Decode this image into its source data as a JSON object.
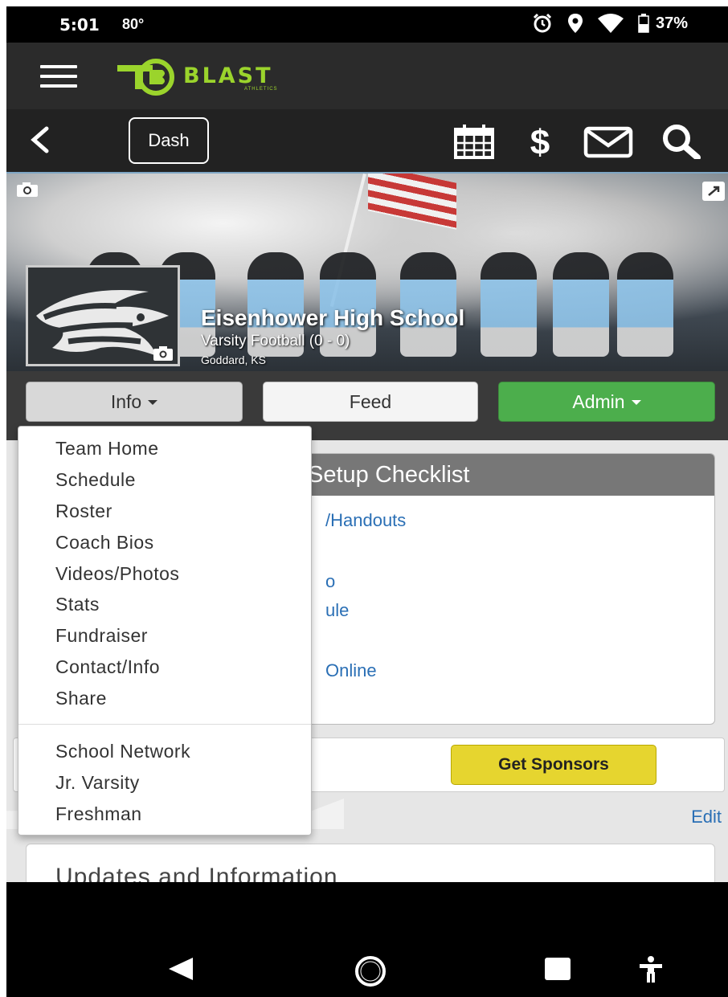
{
  "status_bar": {
    "time": "5:01",
    "temperature": "80°",
    "battery": "37%",
    "icons": [
      "alarm-icon",
      "location-icon",
      "wifi-icon",
      "battery-icon"
    ]
  },
  "brand": {
    "logo_word": "BLAST",
    "logo_sub": "ATHLETICS",
    "accent_color": "#9bd42c"
  },
  "navbar": {
    "dash_label": "Dash",
    "icons": [
      "back-icon",
      "calendar-icon",
      "dollar-icon",
      "mail-icon",
      "search-icon"
    ]
  },
  "banner": {
    "school_name": "Eisenhower High School",
    "team": "Varsity Football (0 - 0)",
    "location": "Goddard, KS"
  },
  "tabs": {
    "info": "Info",
    "feed": "Feed",
    "admin": "Admin",
    "admin_color": "#4cae4c"
  },
  "checklist": {
    "title": "Setup Checklist",
    "items_partial": [
      "/Handouts",
      "o",
      "ule",
      "Online"
    ]
  },
  "sponsors": {
    "button": "Get Sponsors",
    "button_color": "#e6d52f"
  },
  "edit_link": "Edit",
  "updates_title": "Updates and Information",
  "dropdown": {
    "primary": [
      "Team Home",
      "Schedule",
      "Roster",
      "Coach Bios",
      "Videos/Photos",
      "Stats",
      "Fundraiser",
      "Contact/Info",
      "Share"
    ],
    "secondary": [
      "School Network",
      "Jr. Varsity",
      "Freshman"
    ]
  },
  "android_nav": [
    "back-triangle-icon",
    "home-circle-icon",
    "recents-square-icon",
    "accessibility-icon"
  ]
}
